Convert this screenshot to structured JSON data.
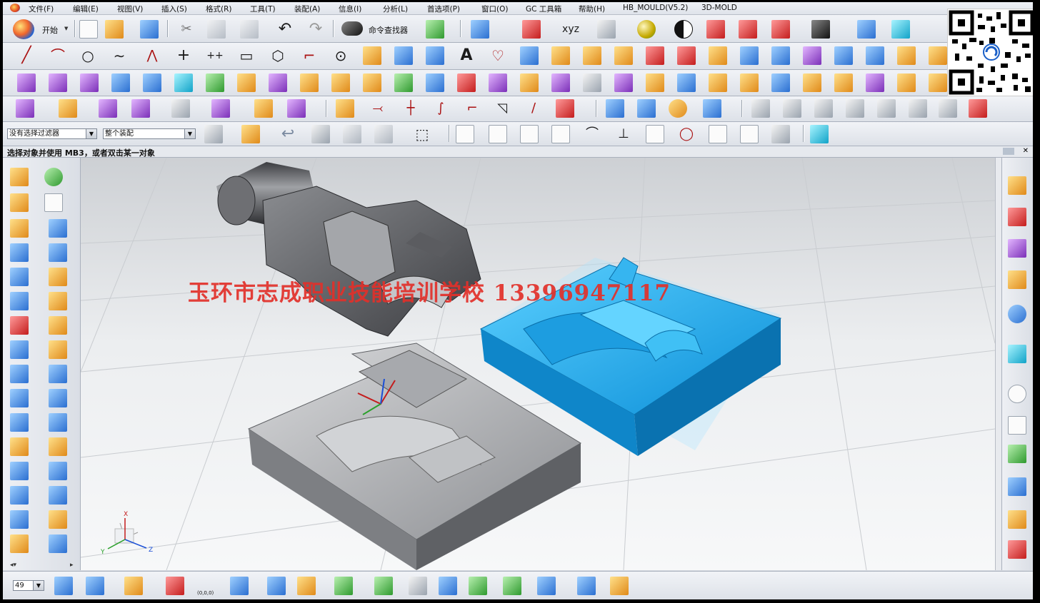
{
  "menubar": {
    "items": [
      "文件(F)",
      "编辑(E)",
      "视图(V)",
      "插入(S)",
      "格式(R)",
      "工具(T)",
      "装配(A)",
      "信息(I)",
      "分析(L)",
      "首选项(P)",
      "窗口(O)",
      "GC 工具箱",
      "帮助(H)",
      "HB_MOULD(V5.2)",
      "3D-MOLD"
    ]
  },
  "toolbar": {
    "start_label": "开始",
    "command_finder_label": "命令查找器"
  },
  "selection_bar": {
    "filter_value": "没有选择过滤器",
    "scope_value": "整个装配"
  },
  "status": {
    "prompt": "选择对象并使用 MB3，或者双击某一对象"
  },
  "viewport": {
    "watermark": "玉环市志成职业技能培训学校  13396947117",
    "triad_labels": {
      "x": "X",
      "y": "Y",
      "z": "Z"
    },
    "part_colors": {
      "core": "#9a9ca0",
      "cavity": "#14a6e8",
      "product": "#5f6064",
      "floor": "#e6e8eb"
    }
  },
  "bottombar": {
    "layer_value": "49",
    "origin_label": "(0,0,0)"
  },
  "icons": {
    "row1": [
      "new-file-icon",
      "open-folder-icon",
      "save-icon",
      "cut-icon",
      "copy-icon",
      "paste-icon",
      "undo-icon",
      "redo-icon",
      "binoculars-icon",
      "refresh-icon",
      "info-icon",
      "fit-view-icon",
      "wcs-icon",
      "shaded-view-icon",
      "sphere-icon",
      "half-circle-icon",
      "red-cube-icon",
      "red-box-icon",
      "red-solid-icon",
      "black-square-icon",
      "move-arrow-icon",
      "move-right-icon"
    ],
    "row2": [
      "line-icon",
      "arc-icon",
      "circle-icon",
      "spline-icon",
      "polyline-icon",
      "point-icon",
      "point-set-icon",
      "rectangle-icon",
      "polygon-icon",
      "fillet-curve-icon",
      "ellipse-icon",
      "surface-icon",
      "helix-icon",
      "ruled-icon",
      "text-icon",
      "offset-curve-icon"
    ],
    "bottom_tools": [
      "layer-settings-icon",
      "layer-visible-icon",
      "wcs-dynamic-icon",
      "wcs-origin-icon",
      "wcs-save-icon",
      "measure-distance-icon",
      "measure-angle-icon"
    ]
  }
}
